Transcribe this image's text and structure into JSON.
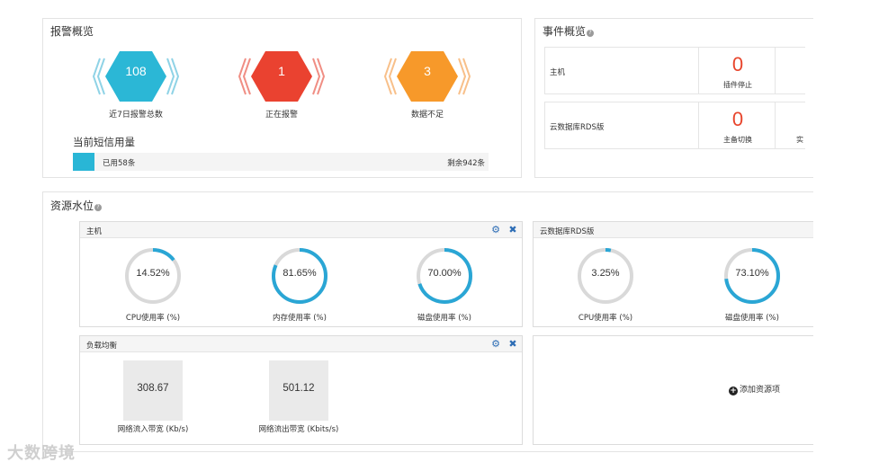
{
  "alarm_overview": {
    "title": "报警概览",
    "badges": [
      {
        "value": "108",
        "label": "近7日报警总数",
        "color": "#2bb7d6",
        "chevron_color": "#8fd3e6"
      },
      {
        "value": "1",
        "label": "正在报警",
        "color": "#ea4230",
        "chevron_color": "#f08e84"
      },
      {
        "value": "3",
        "label": "数据不足",
        "color": "#f7992a",
        "chevron_color": "#f8c08a"
      }
    ],
    "sms": {
      "title": "当前短信用量",
      "used": "已用58条",
      "remaining": "剩余942条",
      "used_fraction": 0.058
    }
  },
  "events_overview": {
    "title": "事件概览",
    "rows": [
      {
        "label": "主机",
        "count": "0",
        "type": "插件停止",
        "extra": ""
      },
      {
        "label": "云数据库RDS版",
        "count": "0",
        "type": "主备切换",
        "extra": "实"
      }
    ]
  },
  "resource_level": {
    "title": "资源水位",
    "widgets": {
      "host": {
        "title": "主机",
        "gauges": [
          {
            "value": "14.52%",
            "label": "CPU使用率 (%)",
            "fraction": 0.1452
          },
          {
            "value": "81.65%",
            "label": "内存使用率 (%)",
            "fraction": 0.8165
          },
          {
            "value": "70.00%",
            "label": "磁盘使用率 (%)",
            "fraction": 0.7
          }
        ]
      },
      "rds": {
        "title": "云数据库RDS版",
        "gauges": [
          {
            "value": "3.25%",
            "label": "CPU使用率 (%)",
            "fraction": 0.0325
          },
          {
            "value": "73.10%",
            "label": "磁盘使用率 (%)",
            "fraction": 0.731
          }
        ]
      },
      "lb": {
        "title": "负载均衡",
        "metrics": [
          {
            "value": "308.67",
            "label": "网络流入带宽 (Kb/s)"
          },
          {
            "value": "501.12",
            "label": "网络流出带宽 (Kbits/s)"
          }
        ]
      }
    },
    "add_item": "添加资源项"
  },
  "watermark": "大数跨境",
  "icons": {
    "settings": "gear-icon",
    "close": "close-icon",
    "add": "plus-circle-icon",
    "help": "question-icon"
  },
  "colors": {
    "gauge_fill": "#2aa6d5",
    "gauge_track": "#d9d9d9",
    "event_count": "#e8452c"
  }
}
